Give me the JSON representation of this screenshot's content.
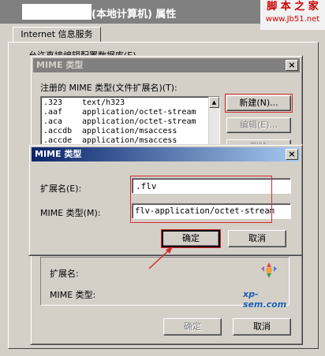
{
  "main": {
    "title": "(本地计算机) 属性",
    "tab": "Internet 信息服务",
    "hidden_text": "允许直接编辑配置数据库(E)"
  },
  "watermark": {
    "site_cn": "脚 本 之 家",
    "site_url": "www.Jb51.net",
    "logo_text": "xp-sem.com"
  },
  "mime_list_dialog": {
    "title": "MIME 类型",
    "list_label": "注册的 MIME 类型(文件扩展名)(T):",
    "rows": [
      {
        "ext": ".323",
        "type": "text/h323"
      },
      {
        "ext": ".aaf",
        "type": "application/octet-stream"
      },
      {
        "ext": ".aca",
        "type": "application/octet-stream"
      },
      {
        "ext": ".accdb",
        "type": "application/msaccess"
      },
      {
        "ext": ".accde",
        "type": "application/msaccess"
      }
    ],
    "new_button": "新建(N)...",
    "edit_button": "编辑(E)...",
    "delete_button": "删除",
    "details_ext_label": "扩展名:",
    "details_type_label": "MIME 类型:",
    "ok": "确定",
    "cancel": "取消"
  },
  "mime_edit_dialog": {
    "title": "MIME 类型",
    "ext_label": "扩展名(E):",
    "ext_value": ".flv",
    "type_label": "MIME 类型(M):",
    "type_value": "flv-application/octet-stream",
    "ok": "确定",
    "cancel": "取消"
  },
  "colors": {
    "titlebar_active": "#0a246a",
    "titlebar_inactive": "#808080",
    "highlight": "#d42a2a"
  }
}
